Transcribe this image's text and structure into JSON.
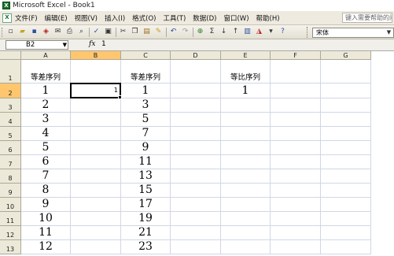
{
  "window": {
    "title": "Microsoft Excel - Book1",
    "app_icon": "excel-icon"
  },
  "menubar": {
    "items": [
      "文件(F)",
      "编辑(E)",
      "视图(V)",
      "插入(I)",
      "格式(O)",
      "工具(T)",
      "数据(D)",
      "窗口(W)",
      "帮助(H)"
    ],
    "help_box": "键入需要帮助的问题"
  },
  "toolbar": {
    "icons": [
      "new-icon",
      "open-icon",
      "save-icon",
      "permission-icon",
      "email-icon",
      "print-icon",
      "print-preview-icon",
      "spelling-icon",
      "research-icon",
      "cut-icon",
      "copy-icon",
      "paste-icon",
      "format-painter-icon",
      "undo-icon",
      "redo-icon",
      "hyperlink-icon",
      "autosum-icon",
      "sort-ascending-icon",
      "sort-descending-icon",
      "chart-wizard-icon",
      "drawing-icon",
      "zoom-icon",
      "help-icon"
    ],
    "font_name": "宋体"
  },
  "formula_bar": {
    "name_box": "B2",
    "fx_label": "fx",
    "value": "1"
  },
  "sheet": {
    "columns": [
      "A",
      "B",
      "C",
      "D",
      "E",
      "F",
      "G"
    ],
    "selected_column": "B",
    "rows": [
      "1",
      "2",
      "3",
      "4",
      "5",
      "6",
      "7",
      "8",
      "9",
      "10",
      "11",
      "12",
      "13"
    ],
    "selected_row": "2",
    "active_cell": "B2",
    "cells": {
      "A1": "等差序列",
      "C1": "等差序列",
      "E1": "等比序列",
      "A2": "1",
      "B2": "1",
      "C2": "1",
      "E2": "1",
      "A3": "2",
      "C3": "3",
      "A4": "3",
      "C4": "5",
      "A5": "4",
      "C5": "7",
      "A6": "5",
      "C6": "9",
      "A7": "6",
      "C7": "11",
      "A8": "7",
      "C8": "13",
      "A9": "8",
      "C9": "15",
      "A10": "9",
      "C10": "17",
      "A11": "10",
      "C11": "19",
      "A12": "11",
      "C12": "21",
      "A13": "12",
      "C13": "23"
    }
  }
}
